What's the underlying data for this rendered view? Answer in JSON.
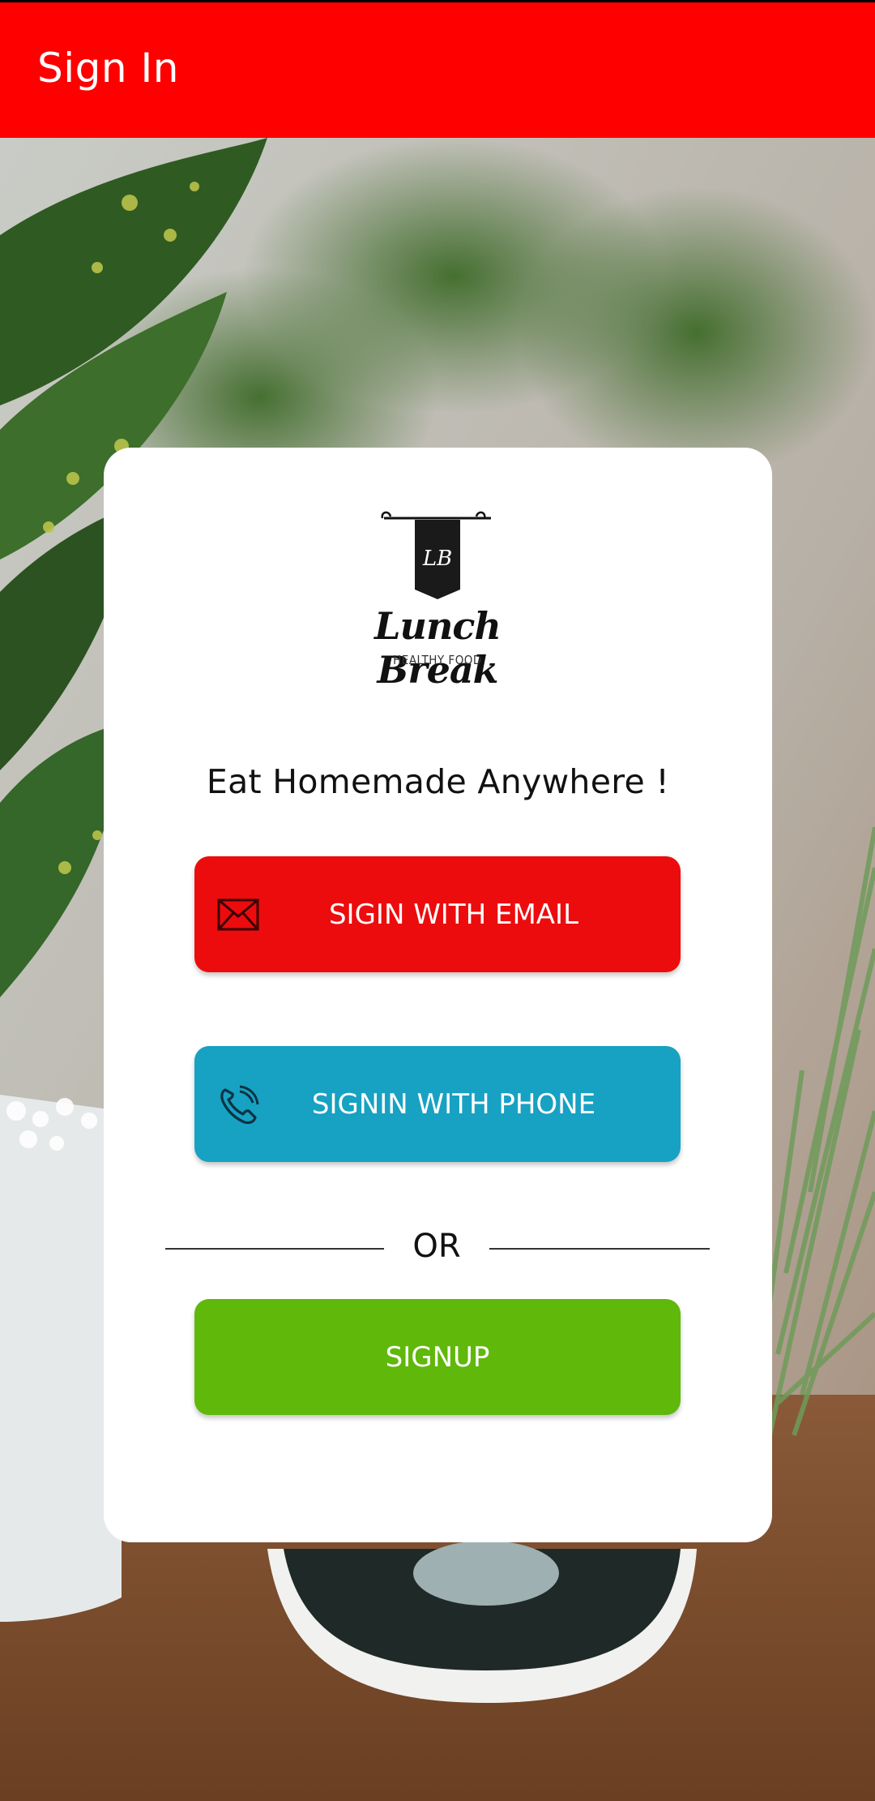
{
  "app_bar": {
    "title": "Sign In",
    "color": "#ff0000"
  },
  "logo": {
    "monogram": "LB",
    "wordmark": "Lunch Break",
    "subtitle": "HEALTHY FOOD"
  },
  "tagline": "Eat Homemade Anywhere !",
  "buttons": {
    "email": {
      "label": "SIGIN WITH EMAIL",
      "icon": "envelope-icon",
      "color": "#ec0c0e"
    },
    "phone": {
      "label": "SIGNIN WITH PHONE",
      "icon": "phone-icon",
      "color": "#17a1c3"
    },
    "signup": {
      "label": "SIGNUP",
      "color": "#5fb80a"
    }
  },
  "divider": {
    "text": "OR"
  }
}
